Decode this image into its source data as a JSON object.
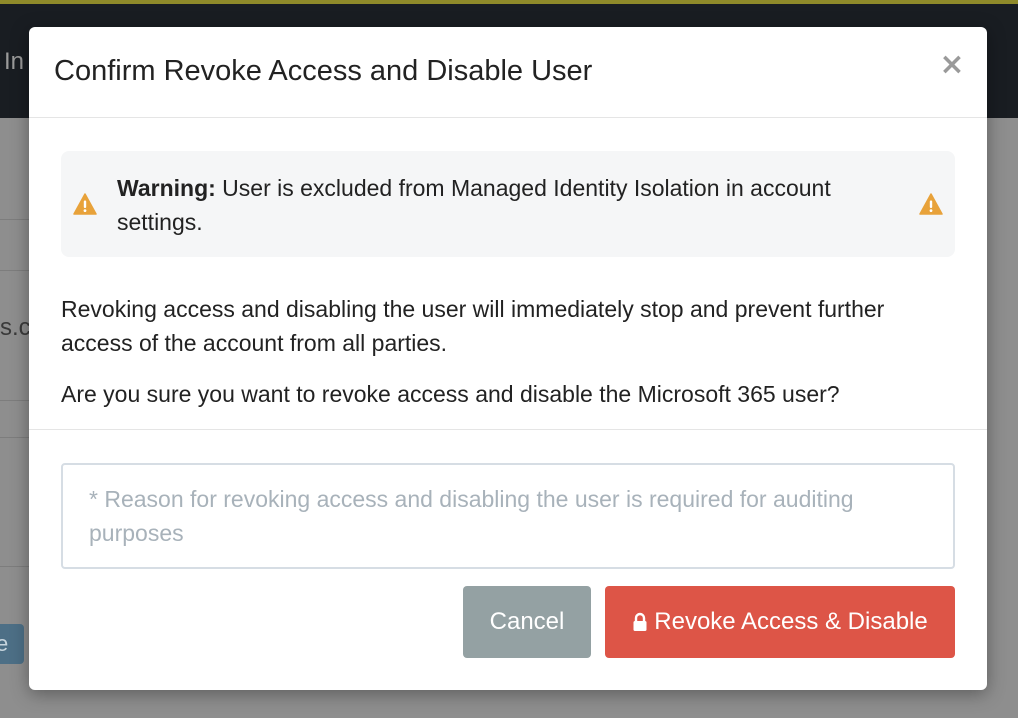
{
  "background": {
    "topbar_fragment": "In",
    "row_fragment": "s.c",
    "button_fragment": "e"
  },
  "modal": {
    "title": "Confirm Revoke Access and Disable User",
    "close_label": "×",
    "warning": {
      "label": "Warning:",
      "text": " User is excluded from Managed Identity Isolation in account settings.",
      "icon": "warning-triangle-icon",
      "icon_color": "#e8a23a"
    },
    "paragraph1": "Revoking access and disabling the user will immediately stop and prevent further access of the account from all parties.",
    "paragraph2": "Are you sure you want to revoke access and disable the Microsoft 365 user?",
    "reason_input": {
      "value": "",
      "placeholder": "* Reason for revoking access and disabling the user is required for auditing purposes"
    },
    "buttons": {
      "cancel_label": "Cancel",
      "revoke_label": "Revoke Access & Disable",
      "revoke_icon": "lock-icon"
    }
  },
  "colors": {
    "danger": "#dd5547",
    "secondary": "#94a1a3",
    "warning": "#e8a23a",
    "overlay": "#8e8e8e"
  }
}
